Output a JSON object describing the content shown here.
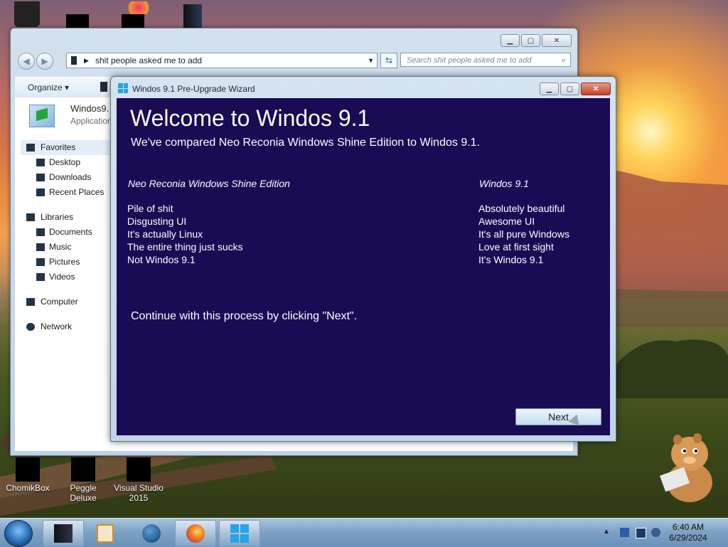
{
  "desktop": {
    "icons": [
      {
        "label": "ChomikBox"
      },
      {
        "label": "Peggle Deluxe"
      },
      {
        "label": "Visual Studio 2015"
      }
    ]
  },
  "explorer": {
    "address": "shit people asked me to add",
    "search_placeholder": "Search shit people asked me to add",
    "organize_label": "Organize ▾",
    "file": {
      "name": "Windos9.",
      "type": "Application"
    },
    "nav": {
      "favorites": "Favorites",
      "desktop": "Desktop",
      "downloads": "Downloads",
      "recent": "Recent Places",
      "libraries": "Libraries",
      "documents": "Documents",
      "music": "Music",
      "pictures": "Pictures",
      "videos": "Videos",
      "computer": "Computer",
      "network": "Network"
    }
  },
  "wizard": {
    "title": "Windos 9.1 Pre-Upgrade Wizard",
    "heading": "Welcome to Windos 9.1",
    "subtitle": "We've compared Neo Reconia Windows Shine Edition  to Windos 9.1.",
    "left_header": "Neo Reconia Windows Shine Edition",
    "right_header": "Windos 9.1",
    "left_items": [
      "Pile of shit",
      "Disgusting UI",
      "It's actually Linux",
      "The entire thing just sucks",
      "Not Windos 9.1"
    ],
    "right_items": [
      "Absolutely beautiful",
      "Awesome UI",
      "It's all pure Windows",
      "Love at first sight",
      "It's Windos 9.1"
    ],
    "continue_text": "Continue with this process by clicking \"Next\".",
    "next_label": "Next",
    "bg_color": "#1a0b55"
  },
  "taskbar": {
    "time": "6:40 AM",
    "date": "6/29/2024"
  }
}
